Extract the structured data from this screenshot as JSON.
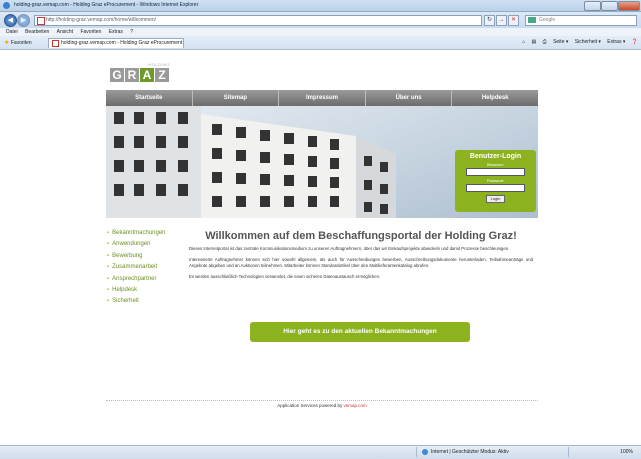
{
  "window": {
    "title": "holding-graz.vemap.com - Holding Graz eProcurement - Windows Internet Explorer",
    "address": "http://holding-graz.vemap.com/home/willkommen/",
    "search_placeholder": "Google"
  },
  "menubar": [
    "Datei",
    "Bearbeiten",
    "Ansicht",
    "Favoriten",
    "Extras",
    "?"
  ],
  "favbar": {
    "favorites_label": "Favoriten",
    "tab_title": "holding-graz.vemap.com - Holding Graz eProcurement",
    "commands": [
      "Seite ▾",
      "Sicherheit ▾",
      "Extras ▾"
    ]
  },
  "logo": {
    "top": "HOLDING",
    "letters": [
      "G",
      "R",
      "A",
      "Z"
    ]
  },
  "nav": [
    "Startseite",
    "Sitemap",
    "Impressum",
    "Über uns",
    "Helpdesk"
  ],
  "login": {
    "title": "Benutzer-Login",
    "user_label": "Benutzer:",
    "password_label": "Passwort:",
    "button": "Login"
  },
  "sidenav": [
    "Bekanntmachungen",
    "Anwendungen",
    "Bewerbung",
    "Zusammenarbeit",
    "Ansprechpartner",
    "Helpdesk",
    "Sicherheit"
  ],
  "main": {
    "heading": "Willkommen auf dem Beschaffungsportal der Holding Graz!",
    "p1": "Dieses Internetportal ist das zentrale Kommunikationsmedium zu unseren Auftragnehmern, über das wir Einkaufsprojekte abwickeln und damit Prozesse beschleunigen.",
    "p2": "Interessierte Auftragnehmer können sich hier sowohl allgemein, als auch für Ausschreibungen bewerben, Ausschreibungsdokumente herunterladen, Teilnahmeanträge und Angebote abgeben und an Auktionen teilnehmen. Mitarbeiter können Standardartikel über den Multilieferantenkatalog abrufen.",
    "p3": "Es werden ausschließlich Technologien verwendet, die einen sicheren Datenaustausch ermöglichen."
  },
  "cta": "Hier geht es zu den aktuellen Bekanntmachungen",
  "footer": {
    "text": "Application Services powered by ",
    "brand": "vemap.com"
  },
  "statusbar": {
    "zone": "Internet | Geschützter Modus: Aktiv",
    "zoom": "100%"
  }
}
